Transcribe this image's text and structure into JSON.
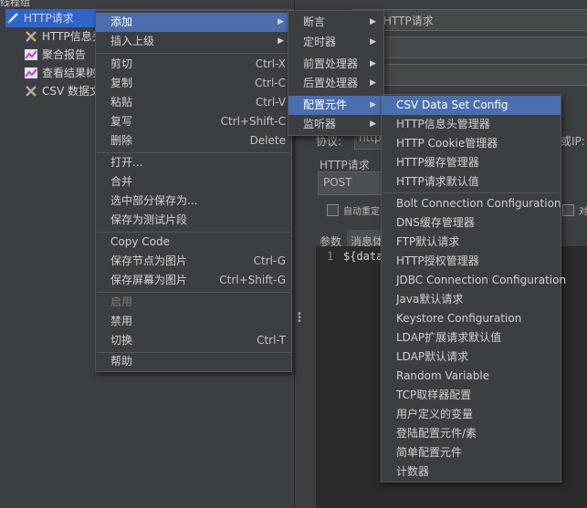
{
  "tree": {
    "top_label": "线程组",
    "items": [
      {
        "label": "HTTP请求",
        "icon": "pencil-icon"
      },
      {
        "label": "HTTP信息头",
        "icon": "wrench-icon"
      },
      {
        "label": "聚合报告",
        "icon": "chart-icon"
      },
      {
        "label": "查看结果树",
        "icon": "chart-icon"
      },
      {
        "label": "CSV 数据文件",
        "icon": "wrench-icon"
      }
    ]
  },
  "right_panel": {
    "title": "HTTP请求",
    "protocol_label": "协议:",
    "protocol_value": "http",
    "ip_label": "或IP:",
    "section_label": "HTTP请求",
    "method": "POST",
    "auto_redirect": "自动重定",
    "checkbox_right": "对",
    "tab_params": "参数",
    "tab_body": "消息体",
    "line_no": "1",
    "editor_text": "${data"
  },
  "context_menu": [
    {
      "label": "添加",
      "submenu": true,
      "highlight": true
    },
    {
      "label": "插入上级",
      "submenu": true
    },
    {
      "sep": true
    },
    {
      "label": "剪切",
      "shortcut": "Ctrl-X"
    },
    {
      "label": "复制",
      "shortcut": "Ctrl-C"
    },
    {
      "label": "粘贴",
      "shortcut": "Ctrl-V"
    },
    {
      "label": "复写",
      "shortcut": "Ctrl+Shift-C"
    },
    {
      "label": "删除",
      "shortcut": "Delete"
    },
    {
      "sep": true
    },
    {
      "label": "打开..."
    },
    {
      "label": "合并"
    },
    {
      "label": "选中部分保存为..."
    },
    {
      "label": "保存为测试片段"
    },
    {
      "sep": true
    },
    {
      "label": "Copy Code"
    },
    {
      "label": "保存节点为图片",
      "shortcut": "Ctrl-G"
    },
    {
      "label": "保存屏幕为图片",
      "shortcut": "Ctrl+Shift-G"
    },
    {
      "sep": true
    },
    {
      "label": "启用",
      "disabled": true
    },
    {
      "label": "禁用"
    },
    {
      "label": "切换",
      "shortcut": "Ctrl-T"
    },
    {
      "sep": true
    },
    {
      "label": "帮助"
    }
  ],
  "add_submenu": [
    {
      "label": "断言"
    },
    {
      "label": "定时器"
    },
    {
      "label": "前置处理器"
    },
    {
      "label": "后置处理器"
    },
    {
      "label": "配置元件",
      "highlight": true
    },
    {
      "label": "监听器"
    }
  ],
  "config_submenu": [
    {
      "label": "CSV Data Set Config",
      "highlight": true
    },
    {
      "label": "HTTP信息头管理器"
    },
    {
      "label": "HTTP Cookie管理器"
    },
    {
      "label": "HTTP缓存管理器"
    },
    {
      "label": "HTTP请求默认值"
    },
    {
      "sep": true
    },
    {
      "label": "Bolt Connection Configuration"
    },
    {
      "label": "DNS缓存管理器"
    },
    {
      "label": "FTP默认请求"
    },
    {
      "label": "HTTP授权管理器"
    },
    {
      "label": "JDBC Connection Configuration"
    },
    {
      "label": "Java默认请求"
    },
    {
      "label": "Keystore Configuration"
    },
    {
      "label": "LDAP扩展请求默认值"
    },
    {
      "label": "LDAP默认请求"
    },
    {
      "label": "Random Variable"
    },
    {
      "label": "TCP取样器配置"
    },
    {
      "label": "用户定义的变量"
    },
    {
      "label": "登陆配置元件/素"
    },
    {
      "label": "简单配置元件"
    },
    {
      "label": "计数器"
    }
  ],
  "colors": {
    "bg": "#3c3f41",
    "highlight": "#4b6eaf",
    "selection": "#2f65ca",
    "editor": "#2b2b2b"
  }
}
